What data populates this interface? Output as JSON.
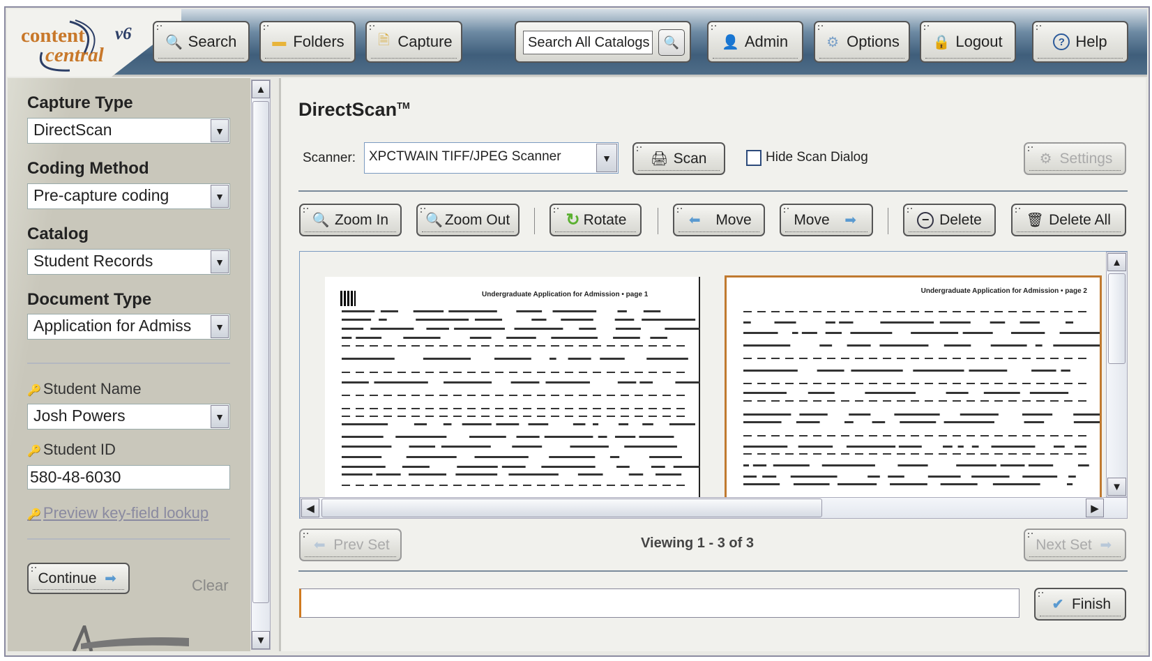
{
  "header": {
    "logo": {
      "line1": "content",
      "line2": "central",
      "version": "v6"
    },
    "nav": [
      {
        "label": "Search",
        "icon": "magnifier-icon"
      },
      {
        "label": "Folders",
        "icon": "folder-icon"
      },
      {
        "label": "Capture",
        "icon": "capture-document-icon"
      }
    ],
    "catalog_search": {
      "value": "Search All Catalogs"
    },
    "nav_right": [
      {
        "label": "Admin",
        "icon": "user-icon"
      },
      {
        "label": "Options",
        "icon": "gear-icon"
      },
      {
        "label": "Logout",
        "icon": "lock-icon"
      },
      {
        "label": "Help",
        "icon": "help-icon"
      }
    ]
  },
  "sidebar": {
    "capture_type": {
      "label": "Capture Type",
      "value": "DirectScan"
    },
    "coding_method": {
      "label": "Coding Method",
      "value": "Pre-capture coding"
    },
    "catalog": {
      "label": "Catalog",
      "value": "Student Records"
    },
    "document_type": {
      "label": "Document Type",
      "value": "Application for Admiss"
    },
    "student_name": {
      "label": "Student Name",
      "value": "Josh Powers"
    },
    "student_id": {
      "label": "Student ID",
      "value": "580-48-6030"
    },
    "preview_link": "Preview key-field lookup",
    "continue_label": "Continue",
    "clear_label": "Clear"
  },
  "main": {
    "title": "DirectScan",
    "trademark": "TM",
    "scanner_label": "Scanner:",
    "scanner_value": "XPCTWAIN TIFF/JPEG Scanner",
    "scan_label": "Scan",
    "hide_scan_dialog": {
      "label": "Hide Scan Dialog",
      "checked": false
    },
    "settings_label": "Settings",
    "toolbar": {
      "zoom_in": "Zoom In",
      "zoom_out": "Zoom Out",
      "rotate": "Rotate",
      "move_left": "Move",
      "move_right": "Move",
      "delete": "Delete",
      "delete_all": "Delete All"
    },
    "pages": [
      {
        "title": "Undergraduate Application for Admission • page 1",
        "selected": false
      },
      {
        "title": "Undergraduate Application for Admission • page 2",
        "selected": true
      }
    ],
    "prev_set": "Prev Set",
    "next_set": "Next Set",
    "viewing": "Viewing 1 - 3 of 3",
    "status_value": "",
    "finish_label": "Finish",
    "selection_color": "#c07a30"
  }
}
